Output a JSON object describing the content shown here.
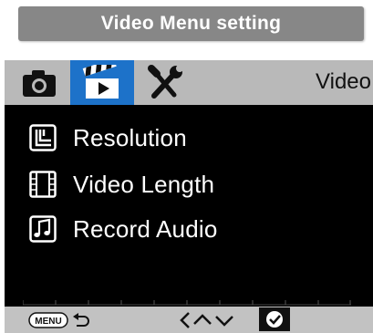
{
  "banner": {
    "title": "Video Menu setting"
  },
  "tabs": [
    {
      "name": "camera",
      "icon": "camera-icon"
    },
    {
      "name": "video",
      "icon": "clapperboard-icon",
      "selected": true
    },
    {
      "name": "tools",
      "icon": "wrench-screwdriver-icon"
    }
  ],
  "header": {
    "title": "Video"
  },
  "menu": {
    "items": [
      {
        "label": "Resolution",
        "icon": "resolution-icon"
      },
      {
        "label": "Video Length",
        "icon": "film-strip-icon"
      },
      {
        "label": "Record Audio",
        "icon": "music-note-icon"
      }
    ]
  },
  "footer": {
    "menu_label": "MENU",
    "icons": [
      "menu-back-icon",
      "chevron-left-icon",
      "chevron-up-icon",
      "chevron-down-icon",
      "confirm-check-icon"
    ]
  },
  "colors": {
    "banner_bg": "#878787",
    "tab_bar_bg": "#b9b9b9",
    "selected_tab_bg": "#1d72c9",
    "screen_bg": "#000000",
    "footer_bg": "#c2c2c2"
  }
}
